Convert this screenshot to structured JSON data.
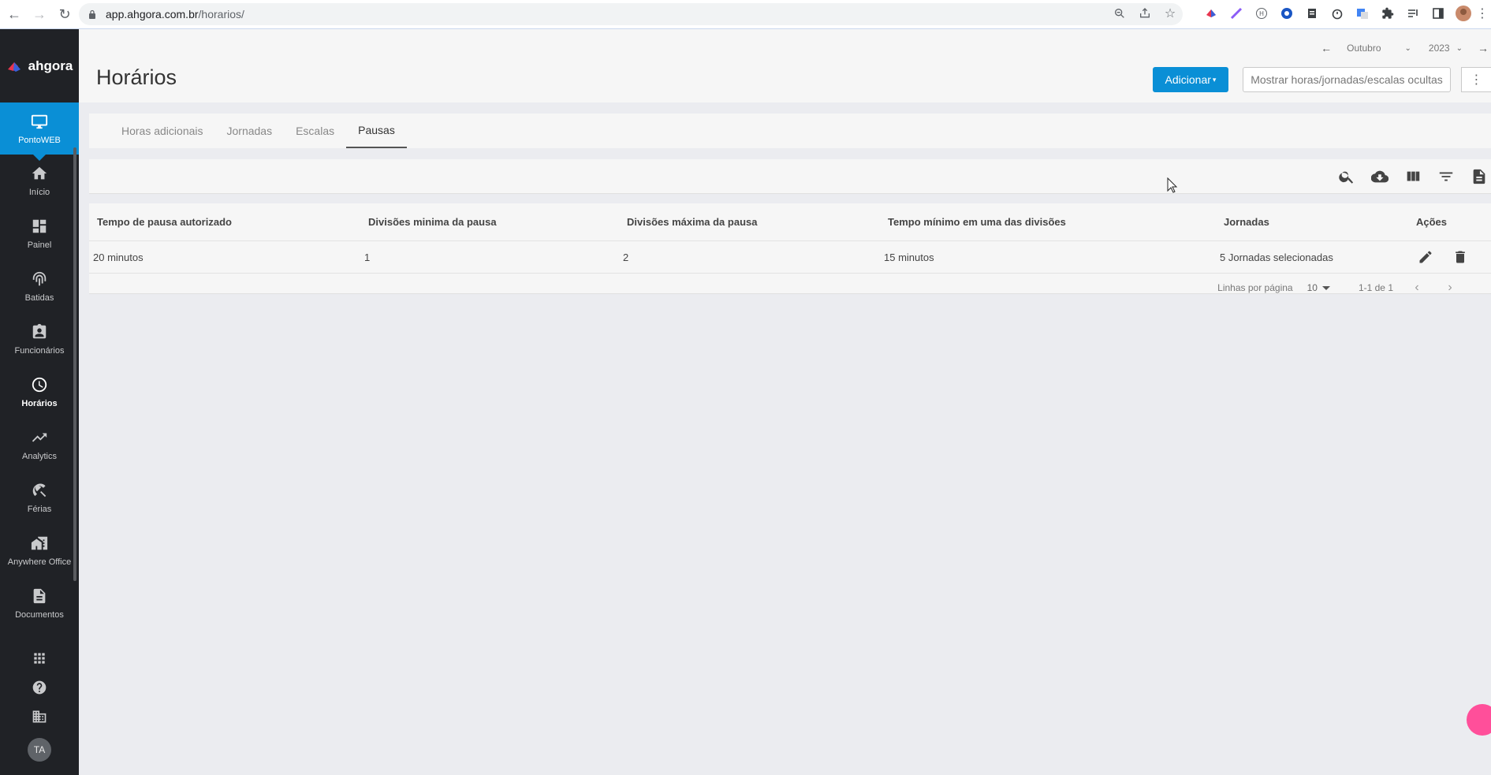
{
  "browser": {
    "url_host": "app.ahgora.com.br",
    "url_path": "/horarios/"
  },
  "sidebar": {
    "brand": "ahgora",
    "items": [
      {
        "label": "PontoWEB",
        "icon": "monitor-icon"
      },
      {
        "label": "Início",
        "icon": "home-icon"
      },
      {
        "label": "Painel",
        "icon": "dashboard-icon"
      },
      {
        "label": "Batidas",
        "icon": "fingerprint-icon"
      },
      {
        "label": "Funcionários",
        "icon": "badge-icon"
      },
      {
        "label": "Horários",
        "icon": "clock-icon"
      },
      {
        "label": "Analytics",
        "icon": "trending-up-icon"
      },
      {
        "label": "Férias",
        "icon": "beach-umbrella-icon"
      },
      {
        "label": "Anywhere Office",
        "icon": "home-work-icon"
      },
      {
        "label": "Documentos",
        "icon": "document-icon"
      }
    ],
    "avatar_initials": "TA"
  },
  "header": {
    "title": "Horários",
    "month": "Outubro",
    "year": "2023",
    "add_button": "Adicionar",
    "show_hidden_button": "Mostrar horas/jornadas/escalas ocultas"
  },
  "tabs": [
    {
      "label": "Horas adicionais",
      "active": false
    },
    {
      "label": "Jornadas",
      "active": false
    },
    {
      "label": "Escalas",
      "active": false
    },
    {
      "label": "Pausas",
      "active": true
    }
  ],
  "table": {
    "columns": [
      "Tempo de pausa autorizado",
      "Divisões minima da pausa",
      "Divisões máxima da pausa",
      "Tempo mínimo em uma das divisões",
      "Jornadas",
      "Ações"
    ],
    "rows": [
      [
        "20 minutos",
        "1",
        "2",
        "15 minutos",
        "5 Jornadas selecionadas"
      ]
    ]
  },
  "pagination": {
    "rows_per_page_label": "Linhas por página",
    "rows_per_page": "10",
    "range": "1-1 de 1"
  },
  "colors": {
    "accent": "#0a8fd6",
    "sidebar_bg": "#202226",
    "chat_bubble": "#ff4f9a"
  }
}
